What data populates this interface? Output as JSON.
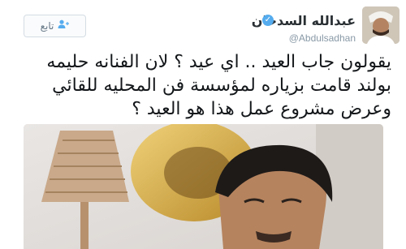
{
  "header": {
    "display_name": "عبدالله السدحان",
    "handle": "@Abdulsadhan",
    "follow_label": "تابع"
  },
  "tweet": {
    "lines": [
      "يقولون جاب العيد .. اي عيد ؟ لان الفنانه حليمه",
      "بولند قامت بزياره لمؤسسة فن المحليه للقائي",
      "وعرض مشروع عمل هذا هو العيد ؟"
    ]
  },
  "icons": {
    "verified": "verified-badge-icon",
    "follow": "add-user-icon"
  },
  "colors": {
    "accent": "#55acee",
    "text": "#14171a",
    "muted": "#8899a6"
  }
}
